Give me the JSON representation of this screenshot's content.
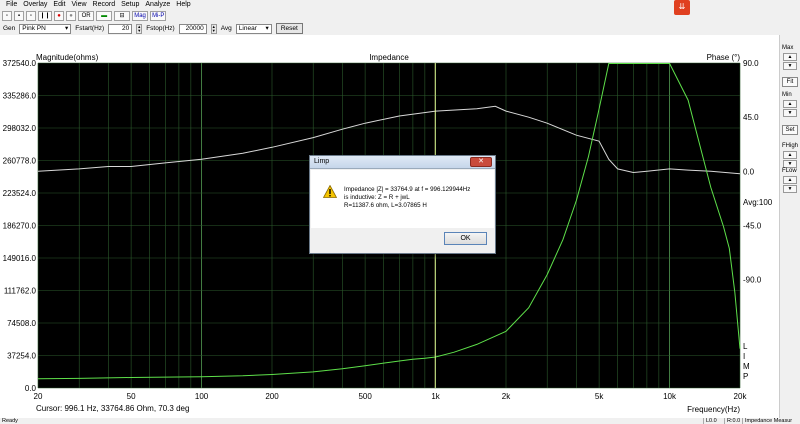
{
  "menu": [
    "File",
    "Overlay",
    "Edit",
    "View",
    "Record",
    "Setup",
    "Analyze",
    "Help"
  ],
  "toolbar1": [
    "▫",
    "▪",
    "▫",
    "❙❙",
    "●",
    "●",
    "OR",
    "▬",
    "⊟",
    "Mag",
    "Mi-P"
  ],
  "toolbar2": {
    "gen_label": "Gen",
    "gen_value": "Pink PN",
    "fstart_label": "Fstart(Hz)",
    "fstart_value": "20",
    "fstop_label": "Fstop(Hz)",
    "fstop_value": "20000",
    "avg_label": "Avg",
    "avg_value": "Linear",
    "reset_label": "Reset"
  },
  "chart_data": {
    "type": "line",
    "title": "Impedance",
    "ylabel_left": "Magnitude(ohms)",
    "ylabel_right": "Phase (°)",
    "xlabel": "Frequency(Hz)",
    "x_scale": "log",
    "xlim": [
      20,
      20000
    ],
    "ylim_left": [
      0,
      372540
    ],
    "ylim_right": [
      -180,
      90
    ],
    "x_ticks": [
      {
        "v": 20,
        "label": "20"
      },
      {
        "v": 50,
        "label": "50"
      },
      {
        "v": 100,
        "label": "100"
      },
      {
        "v": 200,
        "label": "200"
      },
      {
        "v": 500,
        "label": "500"
      },
      {
        "v": 1000,
        "label": "1k"
      },
      {
        "v": 2000,
        "label": "2k"
      },
      {
        "v": 5000,
        "label": "5k"
      },
      {
        "v": 10000,
        "label": "10k"
      },
      {
        "v": 20000,
        "label": "20k"
      }
    ],
    "y_ticks_left": [
      "372540.0",
      "335286.0",
      "298032.0",
      "260778.0",
      "223524.0",
      "186270.0",
      "149016.0",
      "111762.0",
      "74508.0",
      "37254.0",
      "0.0"
    ],
    "y_ticks_right": [
      {
        "v": 90,
        "label": "90.0"
      },
      {
        "v": 45,
        "label": "45.0"
      },
      {
        "v": 0,
        "label": "0.0"
      },
      {
        "v": -45,
        "label": "-45.0"
      },
      {
        "v": -90,
        "label": "-90.0"
      }
    ],
    "avg_label": "Avg:100",
    "limp_label": "LIMP",
    "cursor": "Cursor:   996.1 Hz, 33764.86 Ohm, 70.3 deg",
    "grid": true,
    "background": "#000000",
    "series": [
      {
        "name": "Magnitude",
        "color": "#5ee04a",
        "axis": "left",
        "x": [
          20,
          30,
          50,
          70,
          100,
          150,
          200,
          300,
          400,
          500,
          600,
          700,
          800,
          900,
          1000,
          1200,
          1500,
          2000,
          2500,
          3000,
          3500,
          4000,
          4500,
          5000,
          5500,
          6000,
          7000,
          8000,
          9000,
          10000,
          12000,
          15000,
          17000,
          18000,
          19000,
          20000
        ],
        "y": [
          10500,
          11000,
          12000,
          12500,
          13000,
          14000,
          15500,
          18500,
          22000,
          25500,
          28500,
          31000,
          33000,
          34000,
          35500,
          41000,
          50000,
          65000,
          92000,
          130000,
          170000,
          215000,
          265000,
          320000,
          372000,
          372000,
          372000,
          372000,
          372000,
          372000,
          330000,
          230000,
          185000,
          160000,
          110000,
          45000
        ]
      },
      {
        "name": "Phase",
        "color": "#d8d8d8",
        "axis": "right",
        "x": [
          20,
          30,
          40,
          50,
          70,
          100,
          150,
          200,
          300,
          400,
          500,
          700,
          1000,
          1500,
          1800,
          2000,
          2500,
          3000,
          4000,
          5000,
          5500,
          6000,
          7000,
          8000,
          10000,
          12000,
          15000,
          20000
        ],
        "y": [
          0,
          2,
          4,
          4,
          7,
          10,
          15,
          20,
          28,
          35,
          40,
          46,
          50,
          52,
          54,
          50,
          45,
          40,
          30,
          25,
          10,
          2,
          -1,
          0,
          2,
          1,
          0,
          -2
        ]
      }
    ]
  },
  "right_panel": {
    "max": "Max",
    "fit": "Fit",
    "min": "Min",
    "set": "Set",
    "fhigh": "FHigh",
    "flow": "FLow"
  },
  "status": {
    "ready": "Ready",
    "seg1": "L0.0",
    "seg2": "R:0.0",
    "seg3": "Impedance Measur"
  },
  "dialog": {
    "title": "Limp",
    "line1": "Impedance |Z| = 33764.9 at f = 996.129944Hz",
    "line2": "is inductive: Z = R + jwL",
    "line3": "R=11387.6 ohm, L=3.07865 H",
    "ok": "OK",
    "close": "✕"
  }
}
